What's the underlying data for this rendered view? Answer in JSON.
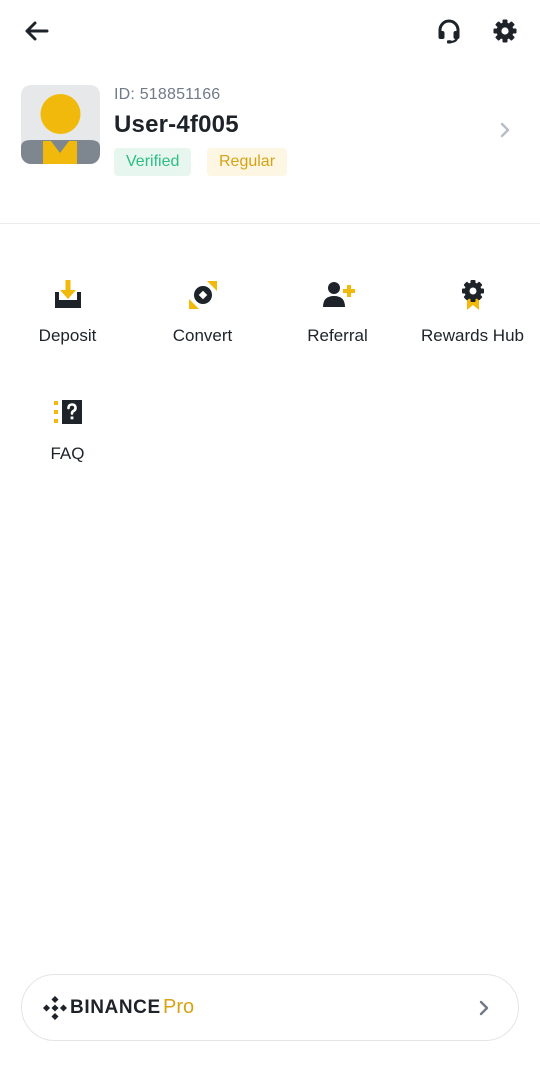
{
  "header": {
    "back_icon": "arrow-left-icon",
    "support_icon": "headset-icon",
    "settings_icon": "gear-icon"
  },
  "profile": {
    "id_text": "ID: 518851166",
    "username": "User-4f005",
    "badges": {
      "verified": "Verified",
      "tier": "Regular"
    },
    "chevron_icon": "chevron-right-icon"
  },
  "shortcuts": [
    {
      "label": "Deposit",
      "icon": "deposit-icon"
    },
    {
      "label": "Convert",
      "icon": "convert-icon"
    },
    {
      "label": "Referral",
      "icon": "add-user-icon"
    },
    {
      "label": "Rewards Hub",
      "icon": "award-icon"
    },
    {
      "label": "FAQ",
      "icon": "faq-icon"
    }
  ],
  "footer": {
    "brand": "BINANCE",
    "suffix": "Pro",
    "chevron_icon": "chevron-right-icon"
  },
  "colors": {
    "accent": "#F0B90B",
    "text": "#1E2329",
    "muted": "#707A8A",
    "verified_text": "#2EBD85",
    "verified_bg": "#E7F7EF",
    "regular_text": "#D6A315",
    "regular_bg": "#FDF6E3"
  }
}
